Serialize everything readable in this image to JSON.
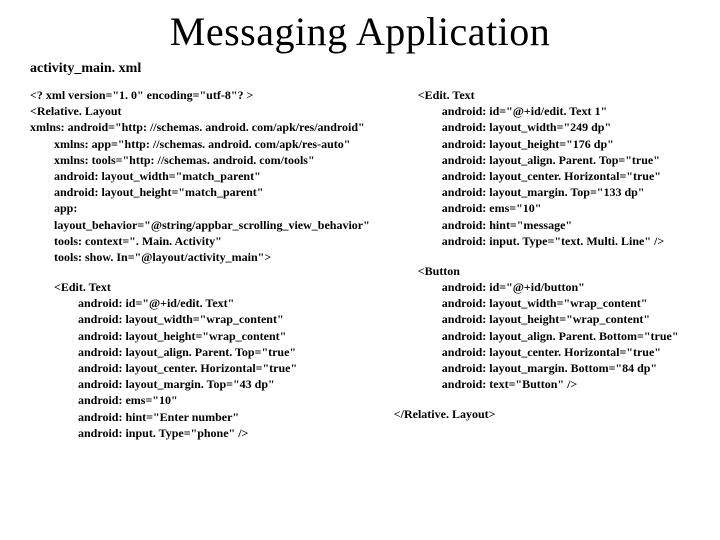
{
  "title": "Messaging Application",
  "subtitle": "activity_main. xml",
  "left": {
    "xmlDecl": "<? xml version=\"1. 0\" encoding=\"utf-8\"? >",
    "root1": "<Relative. Layout",
    "root2": "xmlns: android=\"http: //schemas. android. com/apk/res/android\"",
    "root3": "xmlns: app=\"http: //schemas. android. com/apk/res-auto\"",
    "root4": "xmlns: tools=\"http: //schemas. android. com/tools\"",
    "root5": "android: layout_width=\"match_parent\"",
    "root6": "android: layout_height=\"match_parent\"",
    "root7": "app: layout_behavior=\"@string/appbar_scrolling_view_behavior\"",
    "root8": "tools: context=\". Main. Activity\"",
    "root9": "tools: show. In=\"@layout/activity_main\">",
    "et1_l1": "<Edit. Text",
    "et1_l2": "android: id=\"@+id/edit. Text\"",
    "et1_l3": "android: layout_width=\"wrap_content\"",
    "et1_l4": "android: layout_height=\"wrap_content\"",
    "et1_l5": "android: layout_align. Parent. Top=\"true\"",
    "et1_l6": "android: layout_center. Horizontal=\"true\"",
    "et1_l7": "android: layout_margin. Top=\"43 dp\"",
    "et1_l8": "android: ems=\"10\"",
    "et1_l9": "android: hint=\"Enter number\"",
    "et1_l10": "android: input. Type=\"phone\" />"
  },
  "right": {
    "et2_l1": "<Edit. Text",
    "et2_l2": "android: id=\"@+id/edit. Text 1\"",
    "et2_l3": "android: layout_width=\"249 dp\"",
    "et2_l4": "android: layout_height=\"176 dp\"",
    "et2_l5": "android: layout_align. Parent. Top=\"true\"",
    "et2_l6": "android: layout_center. Horizontal=\"true\"",
    "et2_l7": "android: layout_margin. Top=\"133 dp\"",
    "et2_l8": "android: ems=\"10\"",
    "et2_l9": "android: hint=\"message\"",
    "et2_l10": "android: input. Type=\"text. Multi. Line\" />",
    "bt_l1": "<Button",
    "bt_l2": "android: id=\"@+id/button\"",
    "bt_l3": "android: layout_width=\"wrap_content\"",
    "bt_l4": "android: layout_height=\"wrap_content\"",
    "bt_l5": "android: layout_align. Parent. Bottom=\"true\"",
    "bt_l6": "android: layout_center. Horizontal=\"true\"",
    "bt_l7": "android: layout_margin. Bottom=\"84 dp\"",
    "bt_l8": "android: text=\"Button\" />",
    "close": "</Relative. Layout>"
  }
}
